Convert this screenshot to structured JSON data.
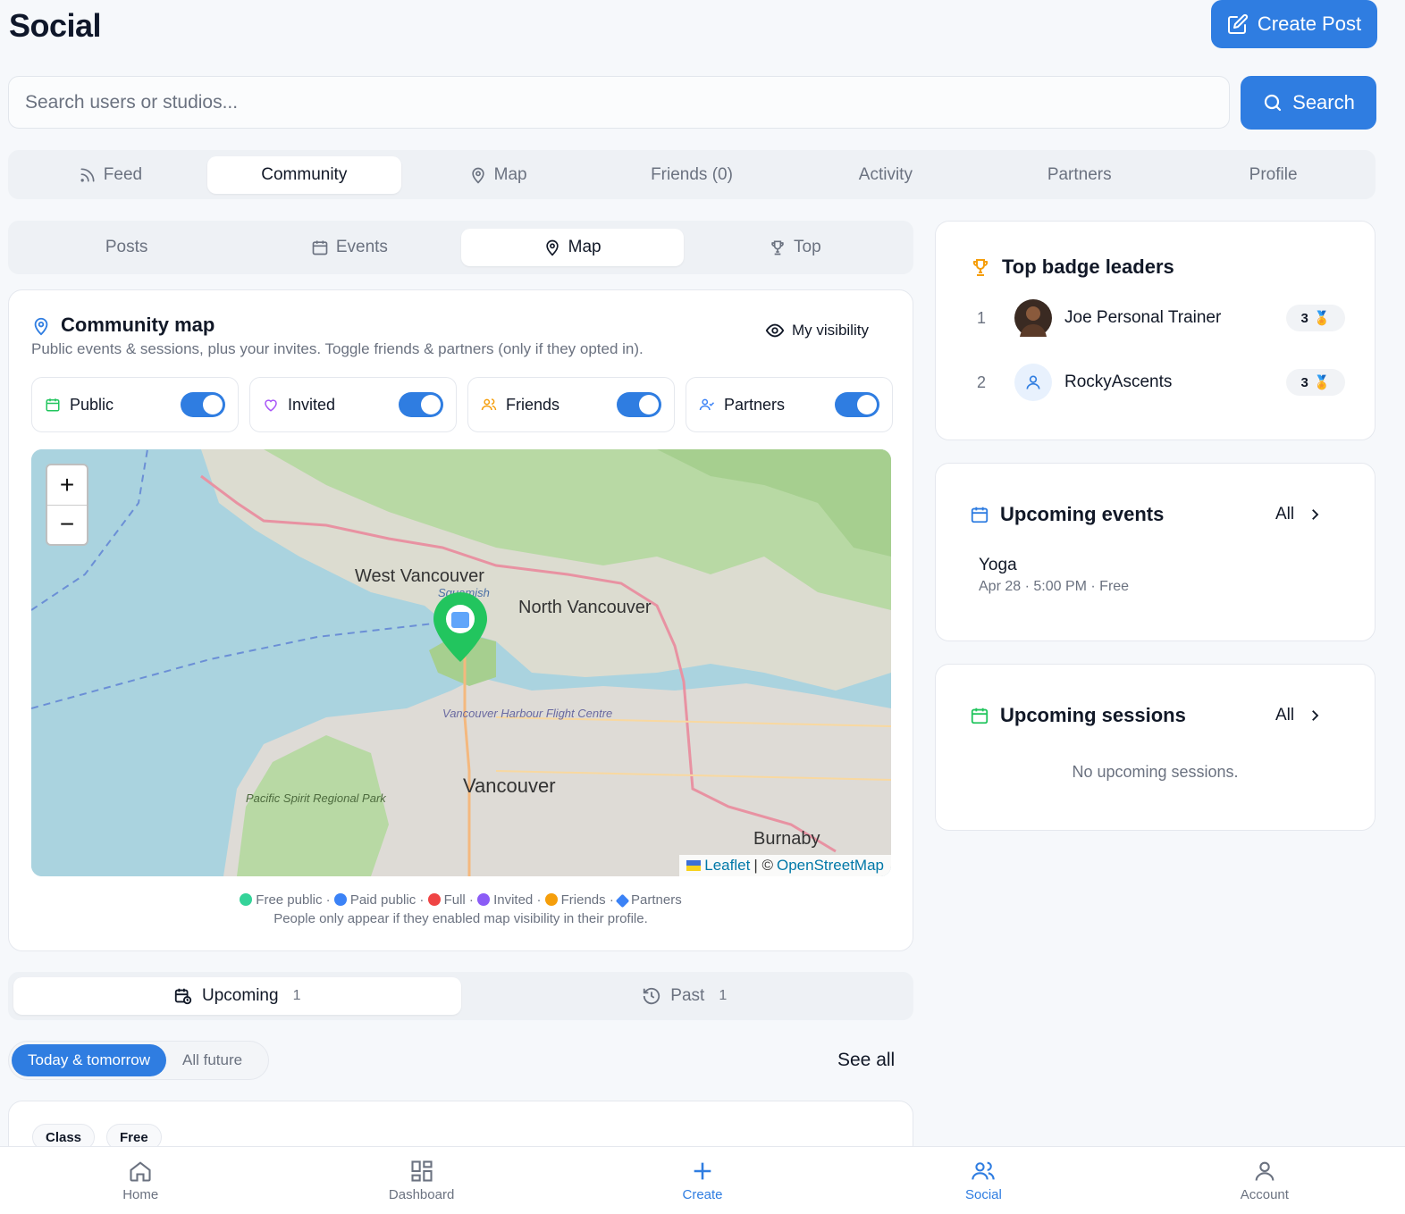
{
  "header": {
    "title": "Social",
    "create_post": "Create Post"
  },
  "search": {
    "placeholder": "Search users or studios...",
    "button": "Search"
  },
  "tabs": [
    "Feed",
    "Community",
    "Map",
    "Friends (0)",
    "Activity",
    "Partners",
    "Profile"
  ],
  "subtabs": [
    "Posts",
    "Events",
    "Map",
    "Top"
  ],
  "community_map": {
    "title": "Community map",
    "subtitle": "Public events & sessions, plus your invites. Toggle friends & partners (only if they opted in).",
    "visibility_label": "My visibility",
    "toggles": [
      {
        "label": "Public",
        "on": true
      },
      {
        "label": "Invited",
        "on": true
      },
      {
        "label": "Friends",
        "on": true
      },
      {
        "label": "Partners",
        "on": true
      }
    ],
    "map_labels": {
      "west_vancouver": "West Vancouver",
      "north_vancouver": "North Vancouver",
      "vancouver": "Vancouver",
      "burnaby": "Burnaby",
      "squamish": "Squamish",
      "harbour": "Vancouver Harbour Flight Centre",
      "park": "Pacific Spirit Regional Park"
    },
    "attribution": {
      "leaflet": "Leaflet",
      "sep": "| ©",
      "osm": "OpenStreetMap"
    },
    "legend": [
      "Free public",
      "Paid public",
      "Full",
      "Invited",
      "Friends",
      "Partners"
    ],
    "legend_note": "People only appear if they enabled map visibility in their profile.",
    "colors": {
      "free": "#22c55e",
      "paid": "#3b82f6",
      "full": "#ef4444",
      "invited": "#8b5cf6",
      "friends": "#f59e0b",
      "partners": "#3b82f6"
    }
  },
  "schedule": {
    "tabs": [
      {
        "label": "Upcoming",
        "count": "1"
      },
      {
        "label": "Past",
        "count": "1"
      }
    ],
    "segments": [
      "Today & tomorrow",
      "All future"
    ],
    "see_all": "See all",
    "event_tags": [
      "Class",
      "Free"
    ]
  },
  "leaders": {
    "title": "Top badge leaders",
    "rows": [
      {
        "rank": "1",
        "name": "Joe Personal Trainer",
        "badges": "3"
      },
      {
        "rank": "2",
        "name": "RockyAscents",
        "badges": "3"
      }
    ]
  },
  "upcoming_events": {
    "title": "Upcoming events",
    "all": "All",
    "event_name": "Yoga",
    "event_meta": "Apr 28 · 5:00 PM · Free"
  },
  "upcoming_sessions": {
    "title": "Upcoming sessions",
    "all": "All",
    "empty": "No upcoming sessions."
  },
  "bottom_nav": [
    "Home",
    "Dashboard",
    "Create",
    "Social",
    "Account"
  ],
  "accent": "#2f7de1"
}
